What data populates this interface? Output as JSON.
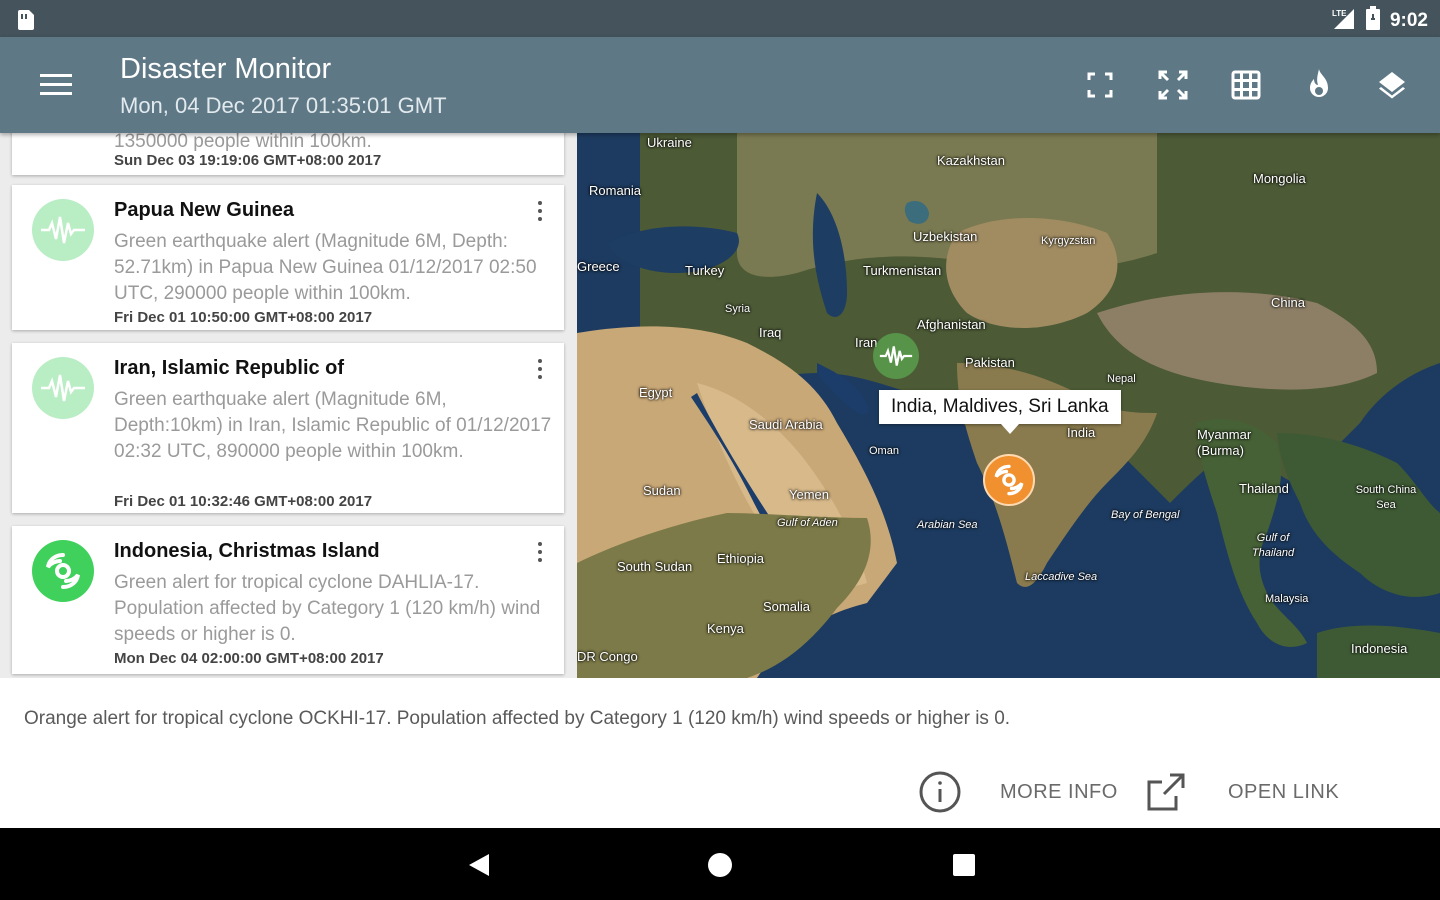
{
  "status_bar": {
    "time": "9:02",
    "network": "LTE"
  },
  "app_bar": {
    "title": "Disaster Monitor",
    "subtitle": "Mon, 04 Dec 2017 01:35:01 GMT"
  },
  "alerts": [
    {
      "title": "",
      "description": "1350000 people within 100km.",
      "date": "Sun Dec 03 19:19:06 GMT+08:00 2017",
      "icon": "earthquake-icon"
    },
    {
      "title": "Papua New Guinea",
      "description": "Green earthquake alert (Magnitude 6M, Depth: 52.71km) in Papua New Guinea 01/12/2017 02:50 UTC, 290000 people within 100km.",
      "date": "Fri Dec 01 10:50:00 GMT+08:00 2017",
      "icon": "earthquake-icon"
    },
    {
      "title": "Iran, Islamic Republic of",
      "description": "Green earthquake alert (Magnitude 6M, Depth:10km) in Iran, Islamic Republic of 01/12/2017 02:32 UTC, 890000 people within 100km.",
      "date": "Fri Dec 01 10:32:46 GMT+08:00 2017",
      "icon": "earthquake-icon"
    },
    {
      "title": "Indonesia, Christmas Island",
      "description": "Green alert for tropical cyclone DAHLIA-17. Population affected by Category 1 (120 km/h) wind speeds or higher is 0.",
      "date": "Mon Dec 04 02:00:00 GMT+08:00 2017",
      "icon": "cyclone-icon"
    }
  ],
  "map": {
    "selected_marker_title": "India, Maldives, Sri Lanka",
    "labels": {
      "ukraine": "Ukraine",
      "kazakhstan": "Kazakhstan",
      "mongolia": "Mongolia",
      "romania": "Romania",
      "uzbekistan": "Uzbekistan",
      "kyrgyzstan": "Kyrgyzstan",
      "greece": "Greece",
      "turkey": "Turkey",
      "turkmenistan": "Turkmenistan",
      "syria": "Syria",
      "china": "China",
      "iraq": "Iraq",
      "iran": "Iran",
      "afghanistan": "Afghanistan",
      "pakistan": "Pakistan",
      "egypt": "Egypt",
      "nepal": "Nepal",
      "saudi_arabia": "Saudi Arabia",
      "india": "India",
      "oman": "Oman",
      "myanmar": "Myanmar (Burma)",
      "sudan": "Sudan",
      "yemen": "Yemen",
      "thailand": "Thailand",
      "south_china_sea": "South China Sea",
      "bay_of_bengal": "Bay of Bengal",
      "gulf_of_aden": "Gulf of Aden",
      "arabian_sea": "Arabian Sea",
      "gulf_of_thailand": "Gulf of Thailand",
      "south_sudan": "South Sudan",
      "ethiopia": "Ethiopia",
      "laccadive_sea": "Laccadive Sea",
      "malaysia": "Malaysia",
      "somalia": "Somalia",
      "kenya": "Kenya",
      "dr_congo": "DR Congo",
      "indonesia": "Indonesia"
    }
  },
  "bottom_sheet": {
    "description": "Orange alert for tropical cyclone OCKHI-17. Population affected by Category 1 (120 km/h) wind speeds or higher is 0.",
    "more_info_label": "MORE INFO",
    "open_link_label": "OPEN LINK"
  },
  "colors": {
    "status_bar": "#44535c",
    "app_bar": "#5e7886",
    "green_alert": "#3fd15c",
    "green_alert_pale": "#b9edc4",
    "orange_alert": "#f0902e"
  }
}
